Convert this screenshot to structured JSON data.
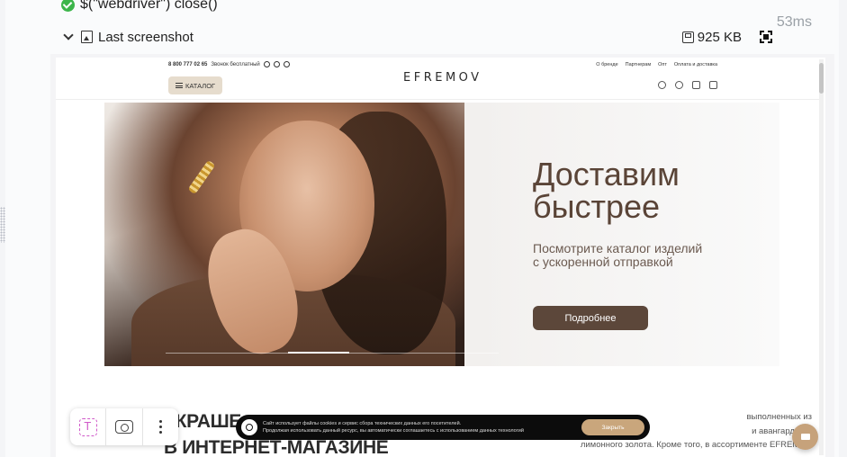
{
  "report": {
    "command": "$(\"webdriver\") close()",
    "duration": "53ms",
    "section_title": "Last screenshot",
    "file_size": "925 KB"
  },
  "site": {
    "phone": "8 800 777 02 65",
    "phone_note": "Звонок бесплатный",
    "catalog_label": "КАТАЛОГ",
    "logo": "EFREMOV",
    "nav": [
      "О бренде",
      "Партнерам",
      "Опт",
      "Оплата и доставка"
    ],
    "hero": {
      "title": "Доставим\nбыстрее",
      "subtitle": "Посмотрите каталог изделий\nс ускоренной отправкой",
      "button": "Подробнее"
    },
    "section_heading": "УКРАШЕ\nВ ИНТЕРНЕТ-МАГАЗИНЕ",
    "section_text": "выполненных из\nи авангардного\nлимонного золота. Кроме того, в ассортименте EFREMOV есть",
    "cookie": {
      "text": "Сайт использует файлы cookies и сервис сбора технических данных его посетителей.\nПродолжая использовать данный ресурс, вы автоматически соглашаетесь с использованием данных технологий",
      "button": "Закрыть"
    }
  },
  "colors": {
    "accent_brown": "#5c473a",
    "cookie_button": "#c9a67c",
    "success_green": "#3cb54a"
  },
  "icons": {
    "status": "check-circle-icon",
    "collapse": "chevron-down-icon",
    "image": "image-icon",
    "size": "save-disk-icon",
    "fullscreen": "expand-icon",
    "toolbar": [
      "text-select-icon",
      "camera-icon",
      "more-vertical-icon"
    ]
  }
}
